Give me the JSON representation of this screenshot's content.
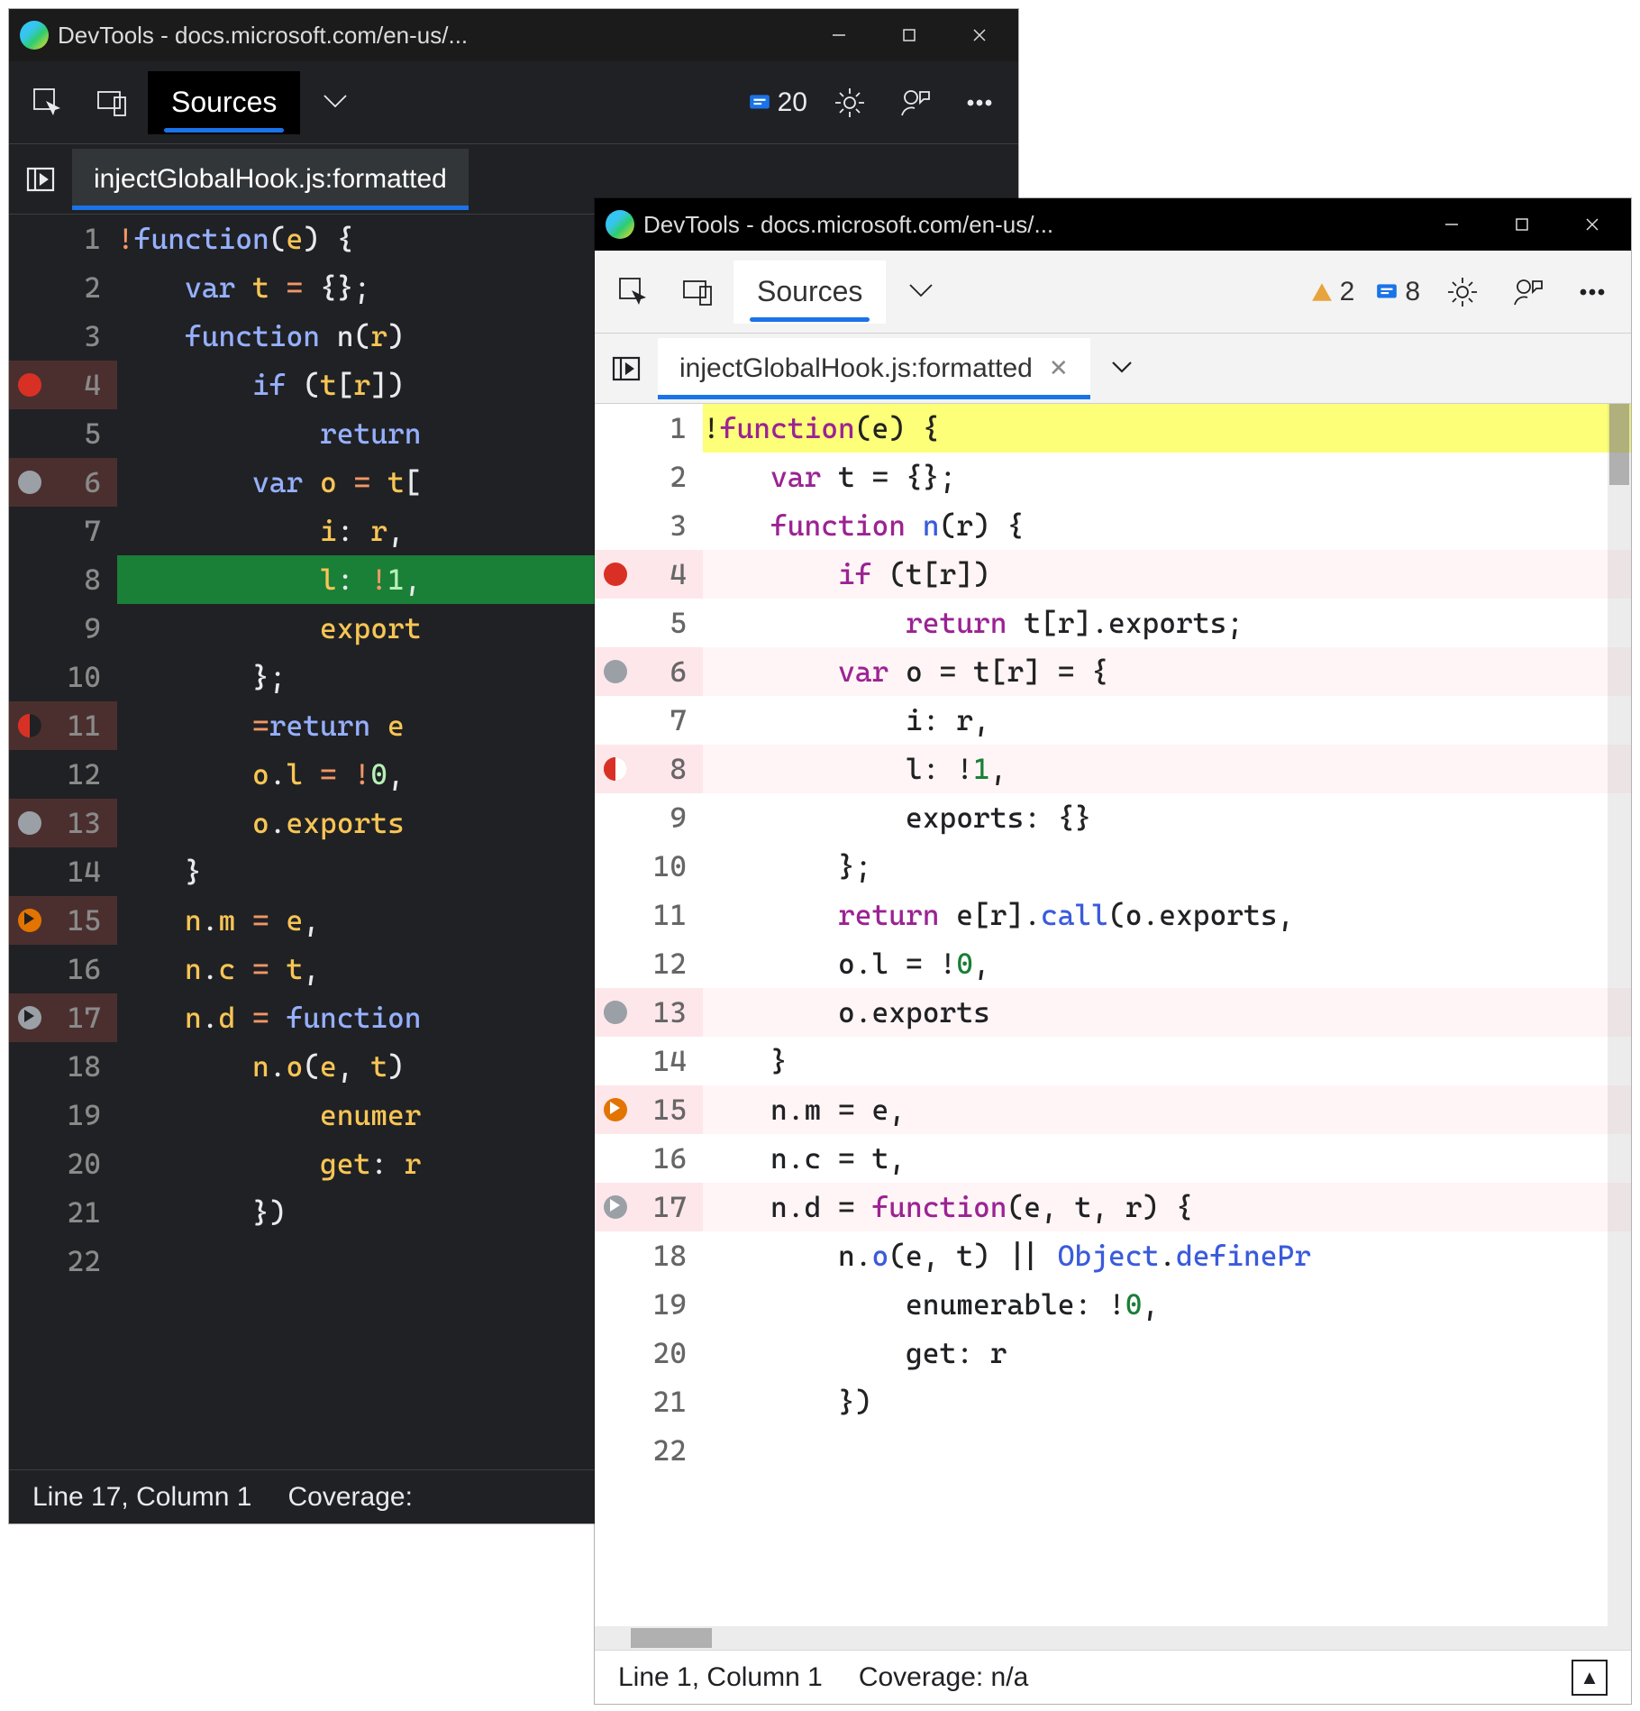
{
  "windows": {
    "dark": {
      "title": "DevTools - docs.microsoft.com/en-us/...",
      "toolbar": {
        "tab": "Sources",
        "error_count": "20"
      },
      "filetab": {
        "name": "injectGlobalHook.js:formatted"
      },
      "status": {
        "position": "Line 17, Column 1",
        "coverage": "Coverage:"
      }
    },
    "light": {
      "title": "DevTools - docs.microsoft.com/en-us/...",
      "toolbar": {
        "tab": "Sources",
        "warn_count": "2",
        "error_count": "8"
      },
      "filetab": {
        "name": "injectGlobalHook.js:formatted"
      },
      "status": {
        "position": "Line 1, Column 1",
        "coverage": "Coverage: n/a"
      }
    }
  },
  "code": {
    "dark": [
      {
        "n": 1,
        "bp": "",
        "cls": "",
        "html": "<span class='op'>!</span><span class='kw'>function</span><span class='pn'>(</span><span class='id'>e</span><span class='pn'>) {</span>"
      },
      {
        "n": 2,
        "bp": "",
        "cls": "",
        "html": "    <span class='kw'>var</span> <span class='id'>t</span> <span class='op'>=</span> <span class='pn'>{};</span>"
      },
      {
        "n": 3,
        "bp": "",
        "cls": "",
        "html": "    <span class='kw'>function</span> <span class='fn'>n</span><span class='pn'>(</span><span class='id'>r</span><span class='pn'>)</span>"
      },
      {
        "n": 4,
        "bp": "full",
        "cls": "bp-row",
        "html": "        <span class='kw'>if</span> <span class='pn'>(</span><span class='id'>t</span><span class='pn'>[</span><span class='id'>r</span><span class='pn'>])</span>"
      },
      {
        "n": 5,
        "bp": "",
        "cls": "",
        "html": "            <span class='kw'>return</span>"
      },
      {
        "n": 6,
        "bp": "gray",
        "cls": "bp-row",
        "html": "        <span class='kw'>var</span> <span class='id'>o</span> <span class='op'>=</span> <span class='id'>t</span><span class='pn'>[</span>"
      },
      {
        "n": 7,
        "bp": "",
        "cls": "",
        "html": "            <span class='id'>i</span><span class='pn'>:</span> <span class='id'>r</span><span class='pn'>,</span>"
      },
      {
        "n": 8,
        "bp": "",
        "cls": "exec",
        "html": "            <span class='id'>l</span><span class='pn'>:</span> <span class='op'>!</span><span class='num'>1</span><span class='pn'>,</span>"
      },
      {
        "n": 9,
        "bp": "",
        "cls": "",
        "html": "            <span class='id'>export</span>"
      },
      {
        "n": 10,
        "bp": "",
        "cls": "",
        "html": "        <span class='pn'>};</span>"
      },
      {
        "n": 11,
        "bp": "log",
        "cls": "bp-row",
        "html": "        <span class='op'>=</span><span class='kw'>return</span> <span class='id'>e</span>"
      },
      {
        "n": 12,
        "bp": "",
        "cls": "",
        "html": "        <span class='id'>o</span><span class='pn'>.</span><span class='id'>l</span> <span class='op'>=</span> <span class='op'>!</span><span class='num'>0</span><span class='pn'>,</span>"
      },
      {
        "n": 13,
        "bp": "graylog",
        "cls": "bp-row",
        "html": "        <span class='id'>o</span><span class='pn'>.</span><span class='id'>exports</span>"
      },
      {
        "n": 14,
        "bp": "",
        "cls": "",
        "html": "    <span class='pn'>}</span>"
      },
      {
        "n": 15,
        "bp": "cond",
        "cls": "bp-row",
        "html": "    <span class='id'>n</span><span class='pn'>.</span><span class='id'>m</span> <span class='op'>=</span> <span class='id'>e</span><span class='pn'>,</span>"
      },
      {
        "n": 16,
        "bp": "",
        "cls": "",
        "html": "    <span class='id'>n</span><span class='pn'>.</span><span class='id'>c</span> <span class='op'>=</span> <span class='id'>t</span><span class='pn'>,</span>"
      },
      {
        "n": 17,
        "bp": "graycond",
        "cls": "bp-row",
        "html": "    <span class='id'>n</span><span class='pn'>.</span><span class='id'>d</span> <span class='op'>=</span> <span class='kw'>function</span>"
      },
      {
        "n": 18,
        "bp": "",
        "cls": "",
        "html": "        <span class='id'>n</span><span class='pn'>.</span><span class='id'>o</span><span class='pn'>(</span><span class='id'>e</span><span class='pn'>,</span> <span class='id'>t</span><span class='pn'>)</span>"
      },
      {
        "n": 19,
        "bp": "",
        "cls": "",
        "html": "            <span class='id'>enumer</span>"
      },
      {
        "n": 20,
        "bp": "",
        "cls": "",
        "html": "            <span class='id'>get</span><span class='pn'>:</span> <span class='id'>r</span>"
      },
      {
        "n": 21,
        "bp": "",
        "cls": "",
        "html": "        <span class='pn'>})</span>"
      },
      {
        "n": 22,
        "bp": "",
        "cls": "",
        "html": ""
      }
    ],
    "light": [
      {
        "n": 1,
        "bp": "",
        "cls": "hl",
        "html": "<span class='op'>!</span><span class='kw'>function</span><span class='pn'>(e) {</span>"
      },
      {
        "n": 2,
        "bp": "",
        "cls": "",
        "html": "    <span class='kw'>var</span> t <span class='op'>=</span> <span class='pn'>{};</span>"
      },
      {
        "n": 3,
        "bp": "",
        "cls": "",
        "html": "    <span class='kw'>function</span> <span class='call'>n</span><span class='pn'>(r) {</span>"
      },
      {
        "n": 4,
        "bp": "full",
        "cls": "bp-row",
        "html": "        <span class='kw'>if</span> <span class='pn'>(t[r])</span>"
      },
      {
        "n": 5,
        "bp": "",
        "cls": "",
        "html": "            <span class='kw'>return</span> t<span class='pn'>[</span>r<span class='pn'>].</span>exports<span class='pn'>;</span>"
      },
      {
        "n": 6,
        "bp": "gray",
        "cls": "bp-row",
        "html": "        <span class='kw'>var</span> o <span class='op'>=</span> t<span class='pn'>[</span>r<span class='pn'>]</span> <span class='op'>=</span> <span class='pn'>{</span>"
      },
      {
        "n": 7,
        "bp": "",
        "cls": "",
        "html": "            i<span class='pn'>:</span> r<span class='pn'>,</span>"
      },
      {
        "n": 8,
        "bp": "log",
        "cls": "bp-row",
        "html": "            l<span class='pn'>:</span> <span class='op'>!</span><span class='num'>1</span><span class='pn'>,</span>"
      },
      {
        "n": 9,
        "bp": "",
        "cls": "",
        "html": "            exports<span class='pn'>:</span> <span class='pn'>{}</span>"
      },
      {
        "n": 10,
        "bp": "",
        "cls": "",
        "html": "        <span class='pn'>};</span>"
      },
      {
        "n": 11,
        "bp": "",
        "cls": "",
        "html": "        <span class='kw'>return</span> e<span class='pn'>[</span>r<span class='pn'>].</span><span class='call'>call</span><span class='pn'>(</span>o<span class='pn'>.</span>exports<span class='pn'>,</span>"
      },
      {
        "n": 12,
        "bp": "",
        "cls": "",
        "html": "        o<span class='pn'>.</span>l <span class='op'>=</span> <span class='op'>!</span><span class='num'>0</span><span class='pn'>,</span>"
      },
      {
        "n": 13,
        "bp": "graylog",
        "cls": "bp-row",
        "html": "        o<span class='pn'>.</span>exports"
      },
      {
        "n": 14,
        "bp": "",
        "cls": "",
        "html": "    <span class='pn'>}</span>"
      },
      {
        "n": 15,
        "bp": "cond",
        "cls": "bp-row",
        "html": "    n<span class='pn'>.</span>m <span class='op'>=</span> e<span class='pn'>,</span>"
      },
      {
        "n": 16,
        "bp": "",
        "cls": "",
        "html": "    n<span class='pn'>.</span>c <span class='op'>=</span> t<span class='pn'>,</span>"
      },
      {
        "n": 17,
        "bp": "graycond",
        "cls": "bp-row",
        "html": "    n<span class='pn'>.</span>d <span class='op'>=</span> <span class='kw'>function</span><span class='pn'>(</span>e<span class='pn'>,</span> t<span class='pn'>,</span> r<span class='pn'>) {</span>"
      },
      {
        "n": 18,
        "bp": "",
        "cls": "",
        "html": "        n<span class='pn'>.</span><span class='call'>o</span><span class='pn'>(</span>e<span class='pn'>,</span> t<span class='pn'>)</span> <span class='op'>||</span> <span class='call'>Object</span><span class='pn'>.</span><span class='call'>definePr</span>"
      },
      {
        "n": 19,
        "bp": "",
        "cls": "",
        "html": "            enumerable<span class='pn'>:</span> <span class='op'>!</span><span class='num'>0</span><span class='pn'>,</span>"
      },
      {
        "n": 20,
        "bp": "",
        "cls": "",
        "html": "            get<span class='pn'>:</span> r"
      },
      {
        "n": 21,
        "bp": "",
        "cls": "",
        "html": "        <span class='pn'>})</span>"
      },
      {
        "n": 22,
        "bp": "",
        "cls": "",
        "html": ""
      }
    ]
  }
}
